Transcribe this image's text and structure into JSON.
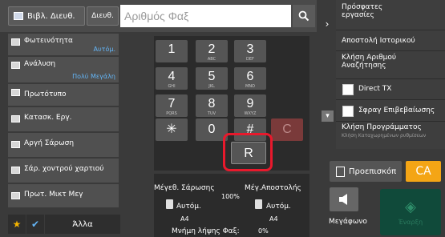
{
  "topbar": {
    "address_book": "Βιβλ. Διευθ.",
    "direct": "Διευθ.",
    "fax_placeholder": "Αριθμός Φαξ",
    "search_icon": "search-icon"
  },
  "left_settings": [
    {
      "label": "Φωτεινότητα",
      "value": "Αυτόμ."
    },
    {
      "label": "Ανάλυση",
      "value": "Πολύ Μεγάλη"
    },
    {
      "label": "Πρωτότυπο",
      "value": ""
    },
    {
      "label": "Κατασκ. Εργ.",
      "value": ""
    },
    {
      "label": "Αργή Σάρωση",
      "value": ""
    },
    {
      "label": "Σάρ. χοντρού χαρτιού",
      "value": ""
    },
    {
      "label": "Πρωτ. Μικτ Μεγ",
      "value": ""
    }
  ],
  "bottom_left": {
    "star": "★",
    "check": "✔",
    "other": "Άλλα"
  },
  "keypad": {
    "k1": {
      "d": "1",
      "s": ""
    },
    "k2": {
      "d": "2",
      "s": "ABC"
    },
    "k3": {
      "d": "3",
      "s": "DEF"
    },
    "k4": {
      "d": "4",
      "s": "GHI"
    },
    "k5": {
      "d": "5",
      "s": "JKL"
    },
    "k6": {
      "d": "6",
      "s": "MNO"
    },
    "k7": {
      "d": "7",
      "s": "PQRS"
    },
    "k8": {
      "d": "8",
      "s": "TUV"
    },
    "k9": {
      "d": "9",
      "s": "WXYZ"
    },
    "star": "✳",
    "k0": "0",
    "hash": "#",
    "clear": "C",
    "r": "R"
  },
  "info": {
    "scan_size": "Μέγεθ. Σάρωσης",
    "send_size": "Μέγ.Αποστολής",
    "ratio": "100%",
    "scan_auto": "Αυτόμ.",
    "send_auto": "Αυτόμ.",
    "scan_paper": "A4",
    "send_paper": "A4",
    "memory_label": "Μνήμη λήψης Φαξ:",
    "memory_value": "0%"
  },
  "right_panel": {
    "recent_jobs": "Πρόσφατες εργασίες",
    "send_history": "Αποστολή Ιστορικού",
    "search_call": "Κλήση Αριθμού Αναζήτησης",
    "direct_tx": "Direct TX",
    "confirm_stamp": "Σφραγ Επιβεβαίωσης",
    "program_call": "Κλήση Προγράμματος",
    "program_sub": "Κλήση Καταχωρημένων ρυθμίσεων"
  },
  "actions": {
    "preview": "Προεπισκόπ",
    "ca": "CA",
    "speaker": "Μεγάφωνο",
    "start": "Έναρξη"
  },
  "colors": {
    "accent_blue": "#64b5f6",
    "ca_orange": "#f4a515",
    "highlight_red": "#e8192c",
    "start_green": "#104a3a"
  }
}
